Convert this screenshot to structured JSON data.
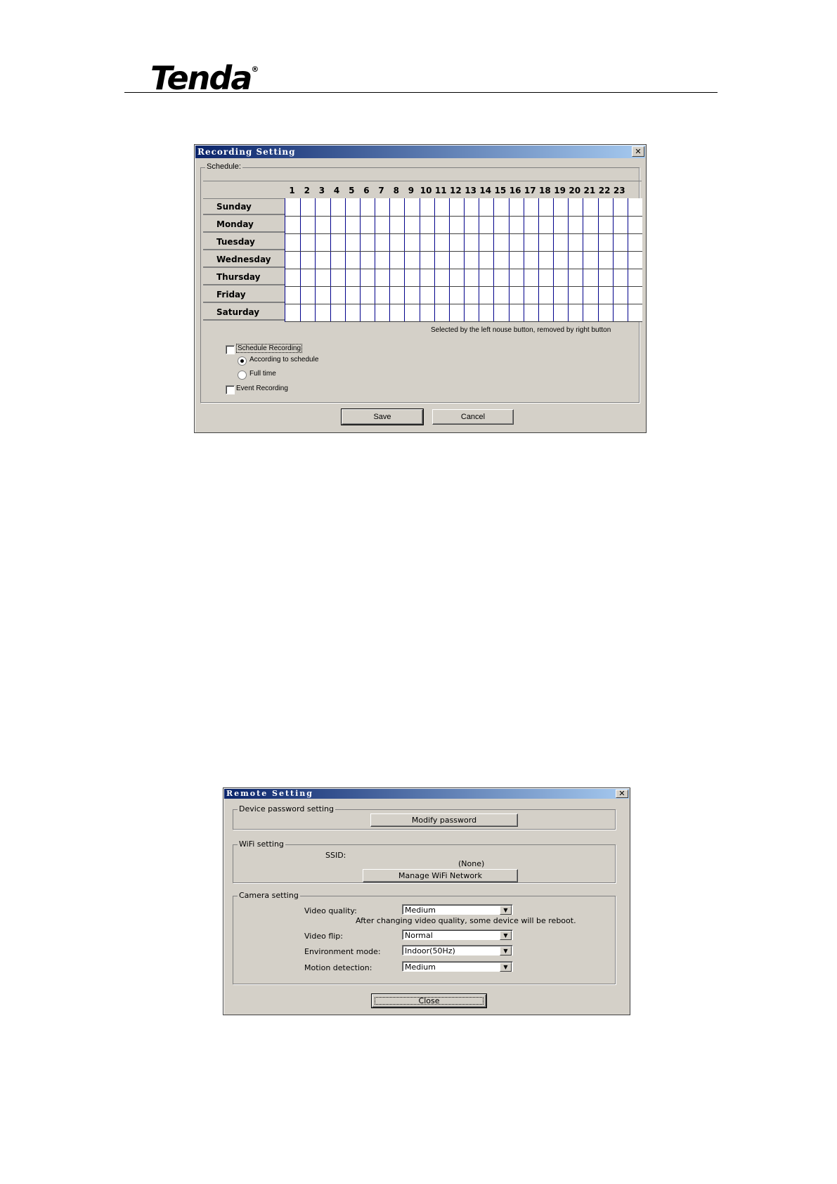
{
  "header": {
    "logo_text": "Tenda",
    "logo_mark": "®"
  },
  "recording": {
    "title": "Recording Setting",
    "close_symbol": "✕",
    "schedule_group": "Schedule:",
    "hours": [
      "1",
      "2",
      "3",
      "4",
      "5",
      "6",
      "7",
      "8",
      "9",
      "10",
      "11",
      "12",
      "13",
      "14",
      "15",
      "16",
      "17",
      "18",
      "19",
      "20",
      "21",
      "22",
      "23"
    ],
    "days": [
      "Sunday",
      "Monday",
      "Tuesday",
      "Wednesday",
      "Thursday",
      "Friday",
      "Saturday"
    ],
    "hint": "Selected by the left nouse button, removed by right button",
    "schedule_recording": "Schedule Recording",
    "according_to_schedule": "According to schedule",
    "full_time": "Full time",
    "event_recording": "Event Recording",
    "save": "Save",
    "cancel": "Cancel"
  },
  "remote": {
    "title": "Remote Setting",
    "close_symbol": "✕",
    "device_group": "Device password setting",
    "modify_password": "Modify password",
    "wifi_group": "WiFi setting",
    "ssid_label": "SSID:",
    "ssid_value": "(None)",
    "manage_wifi": "Manage WiFi Network",
    "camera_group": "Camera setting",
    "video_quality_label": "Video quality:",
    "video_quality_value": "Medium",
    "reboot_note": "After changing video quality, some device will be reboot.",
    "video_flip_label": "Video flip:",
    "video_flip_value": "Normal",
    "environment_label": "Environment mode:",
    "environment_value": "Indoor(50Hz)",
    "motion_label": "Motion detection:",
    "motion_value": "Medium",
    "close": "Close",
    "dropdown_arrow": "▼"
  }
}
